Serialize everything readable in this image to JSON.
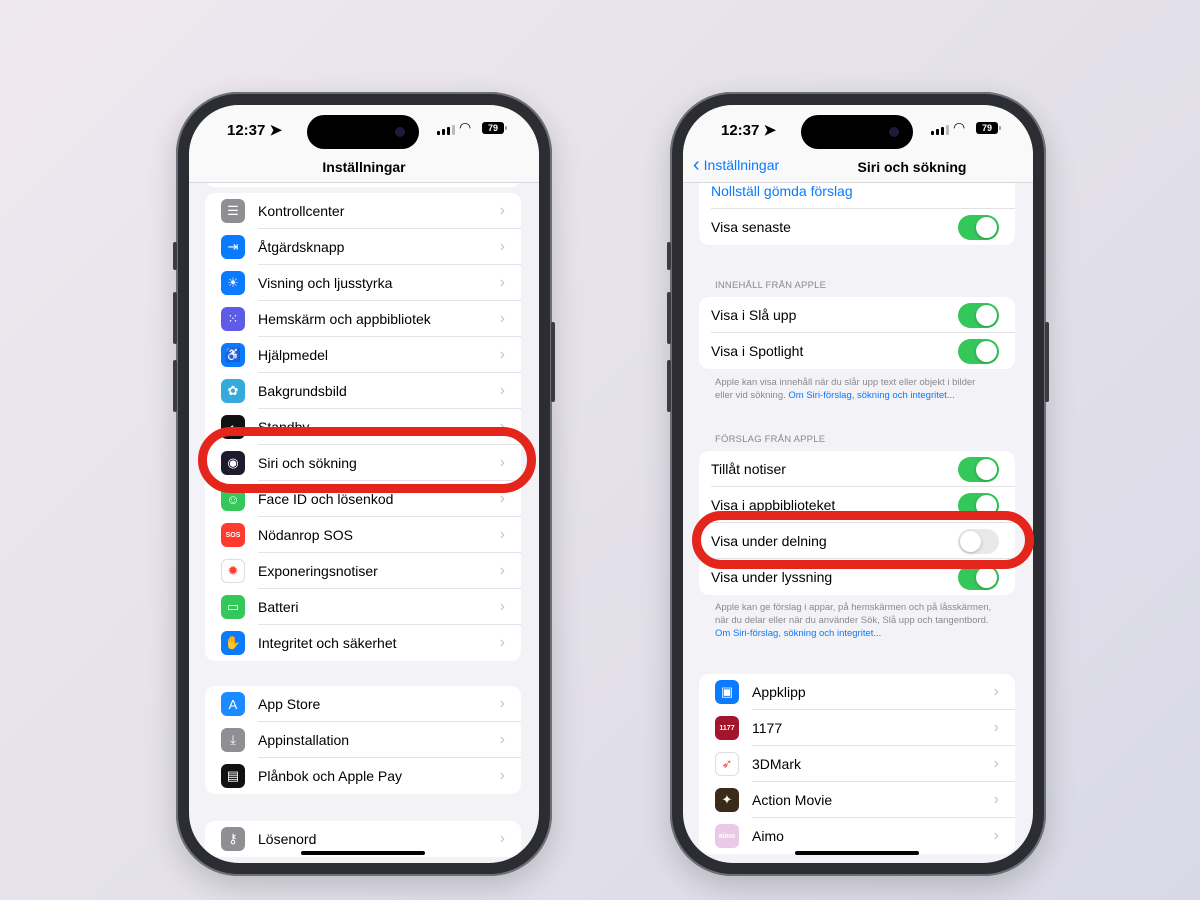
{
  "status": {
    "time": "12:37",
    "battery": "79"
  },
  "left": {
    "title": "Inställningar",
    "groups": [
      [
        {
          "label": "Kontrollcenter",
          "icon": "control-center-icon",
          "color": "#8e8e93",
          "glyph": "☰"
        },
        {
          "label": "Åtgärdsknapp",
          "icon": "action-button-icon",
          "color": "#0a7aff",
          "glyph": "⇥"
        },
        {
          "label": "Visning och ljusstyrka",
          "icon": "brightness-icon",
          "color": "#0a7aff",
          "glyph": "☀"
        },
        {
          "label": "Hemskärm och appbibliotek",
          "icon": "home-screen-icon",
          "color": "#5e5ce6",
          "glyph": "⁙"
        },
        {
          "label": "Hjälpmedel",
          "icon": "accessibility-icon",
          "color": "#0a7aff",
          "glyph": "♿"
        },
        {
          "label": "Bakgrundsbild",
          "icon": "wallpaper-icon",
          "color": "#35aadc",
          "glyph": "✿"
        },
        {
          "label": "Standby",
          "icon": "standby-icon",
          "color": "#111111",
          "glyph": "◐"
        },
        {
          "label": "Siri och sökning",
          "icon": "siri-icon",
          "color": "#1c1c2e",
          "glyph": "◉"
        },
        {
          "label": "Face ID och lösenkod",
          "icon": "face-id-icon",
          "color": "#34c759",
          "glyph": "☺"
        },
        {
          "label": "Nödanrop SOS",
          "icon": "sos-icon",
          "color": "#ff3b30",
          "glyph": "SOS"
        },
        {
          "label": "Exponeringsnotiser",
          "icon": "exposure-icon",
          "color": "#ffffff",
          "glyph": "✹"
        },
        {
          "label": "Batteri",
          "icon": "battery-icon",
          "color": "#34c759",
          "glyph": "▭"
        },
        {
          "label": "Integritet och säkerhet",
          "icon": "privacy-hand-icon",
          "color": "#0a7aff",
          "glyph": "✋"
        }
      ],
      [
        {
          "label": "App Store",
          "icon": "app-store-icon",
          "color": "#1a8cff",
          "glyph": "A"
        },
        {
          "label": "Appinstallation",
          "icon": "app-install-icon",
          "color": "#8e8e93",
          "glyph": "⤓"
        },
        {
          "label": "Plånbok och Apple Pay",
          "icon": "wallet-icon",
          "color": "#111111",
          "glyph": "▤"
        }
      ],
      [
        {
          "label": "Lösenord",
          "icon": "key-icon",
          "color": "#8e8e93",
          "glyph": "⚷"
        }
      ]
    ]
  },
  "right": {
    "back_label": "Inställningar",
    "title": "Siri och sökning",
    "top_rows": [
      {
        "label": "Nollställ gömda förslag",
        "link": true
      },
      {
        "label": "Visa senaste",
        "toggle": true
      }
    ],
    "section1": {
      "header": "INNEHÅLL FRÅN APPLE",
      "rows": [
        {
          "label": "Visa i Slå upp",
          "toggle": true
        },
        {
          "label": "Visa i Spotlight",
          "toggle": true
        }
      ],
      "footer": "Apple kan visa innehåll när du slår upp text eller objekt i bilder eller vid sökning. ",
      "footer_link": "Om Siri-förslag, sökning och integritet..."
    },
    "section2": {
      "header": "FÖRSLAG FRÅN APPLE",
      "rows": [
        {
          "label": "Tillåt notiser",
          "toggle": true
        },
        {
          "label": "Visa i appbiblioteket",
          "toggle": true
        },
        {
          "label": "Visa under delning",
          "toggle": false
        },
        {
          "label": "Visa under lyssning",
          "toggle": true
        }
      ],
      "footer": "Apple kan ge förslag i appar, på hemskärmen och på låsskärmen, när du delar eller när du använder Sök, Slå upp och tangentbord. ",
      "footer_link": "Om Siri-förslag, sökning och integritet..."
    },
    "apps": [
      {
        "label": "Appklipp",
        "icon": "app-clips-icon",
        "color": "#0a7aff",
        "glyph": "▣"
      },
      {
        "label": "1177",
        "icon": "app-1177-icon",
        "color": "#a3152a",
        "glyph": "1177"
      },
      {
        "label": "3DMark",
        "icon": "app-3dmark-icon",
        "color": "#ffffff",
        "glyph": "➶"
      },
      {
        "label": "Action Movie",
        "icon": "app-action-movie-icon",
        "color": "#3a2a1a",
        "glyph": "✦"
      },
      {
        "label": "Aimo",
        "icon": "app-aimo-icon",
        "color": "#e9c9e6",
        "glyph": "aimo"
      }
    ]
  },
  "colors": {
    "highlight": "#e3251b",
    "toggle_on": "#34c759",
    "link": "#0a7aff"
  }
}
